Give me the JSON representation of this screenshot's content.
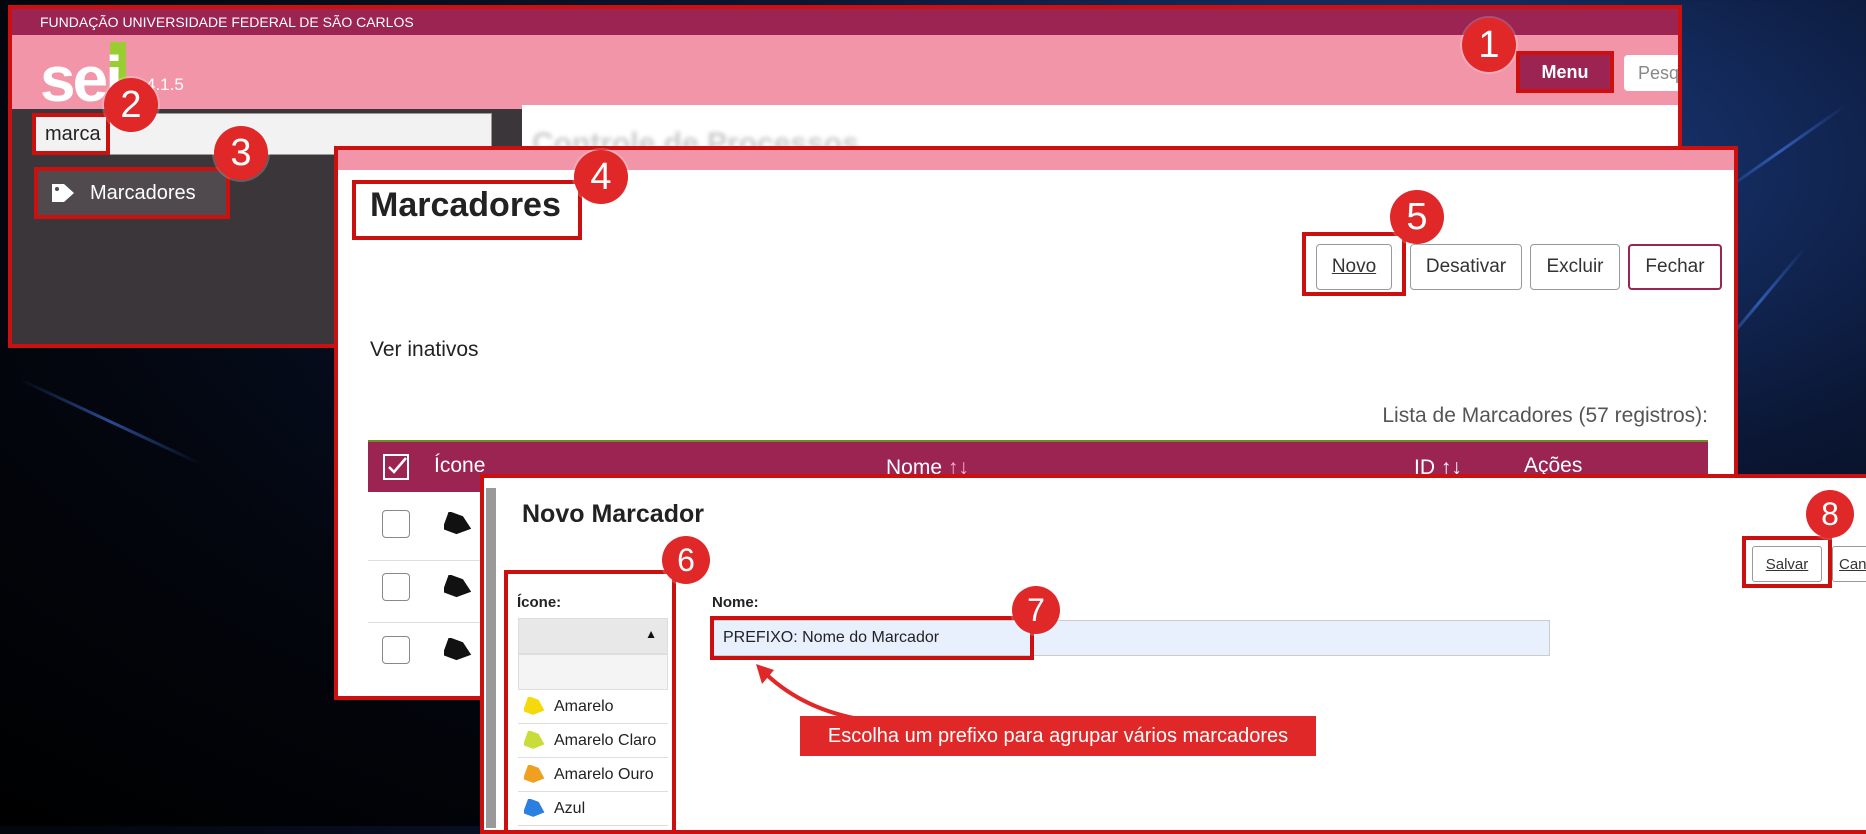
{
  "topbar": {
    "institution": "FUNDAÇÃO UNIVERSIDADE FEDERAL DE SÃO CARLOS"
  },
  "header": {
    "logo": "sei",
    "version": "4.1.5",
    "menu_label": "Menu",
    "search_placeholder": "Pesq"
  },
  "sidebar": {
    "search_value": "marca",
    "result_label": "Marcadores"
  },
  "background_page": {
    "title": "Controle de Processos"
  },
  "marcadores": {
    "title": "Marcadores",
    "buttons": {
      "novo": "Novo",
      "desativar": "Desativar",
      "excluir": "Excluir",
      "fechar": "Fechar"
    },
    "ver_inativos": "Ver inativos",
    "lista_caption": "Lista de Marcadores (57 registros):",
    "columns": {
      "icone": "Ícone",
      "nome": "Nome",
      "id": "ID",
      "acoes": "Ações"
    }
  },
  "novo_marcador": {
    "title": "Novo Marcador",
    "icone_label": "Ícone:",
    "nome_label": "Nome:",
    "nome_value": "PREFIXO: Nome do Marcador",
    "salvar_label": "Salvar",
    "cancelar_label": "Canc",
    "tooltip": "Escolha um prefixo para agrupar vários marcadores",
    "icon_options": [
      {
        "label": "Amarelo",
        "color": "#f5d90a"
      },
      {
        "label": "Amarelo Claro",
        "color": "#c9dd3a"
      },
      {
        "label": "Amarelo Ouro",
        "color": "#f0a020"
      },
      {
        "label": "Azul",
        "color": "#2a7fe0"
      }
    ]
  },
  "badges": [
    "1",
    "2",
    "3",
    "4",
    "5",
    "6",
    "7",
    "8"
  ],
  "colors": {
    "accent": "#9b2452",
    "header_pink": "#f395a9",
    "highlight": "#cc1010"
  }
}
